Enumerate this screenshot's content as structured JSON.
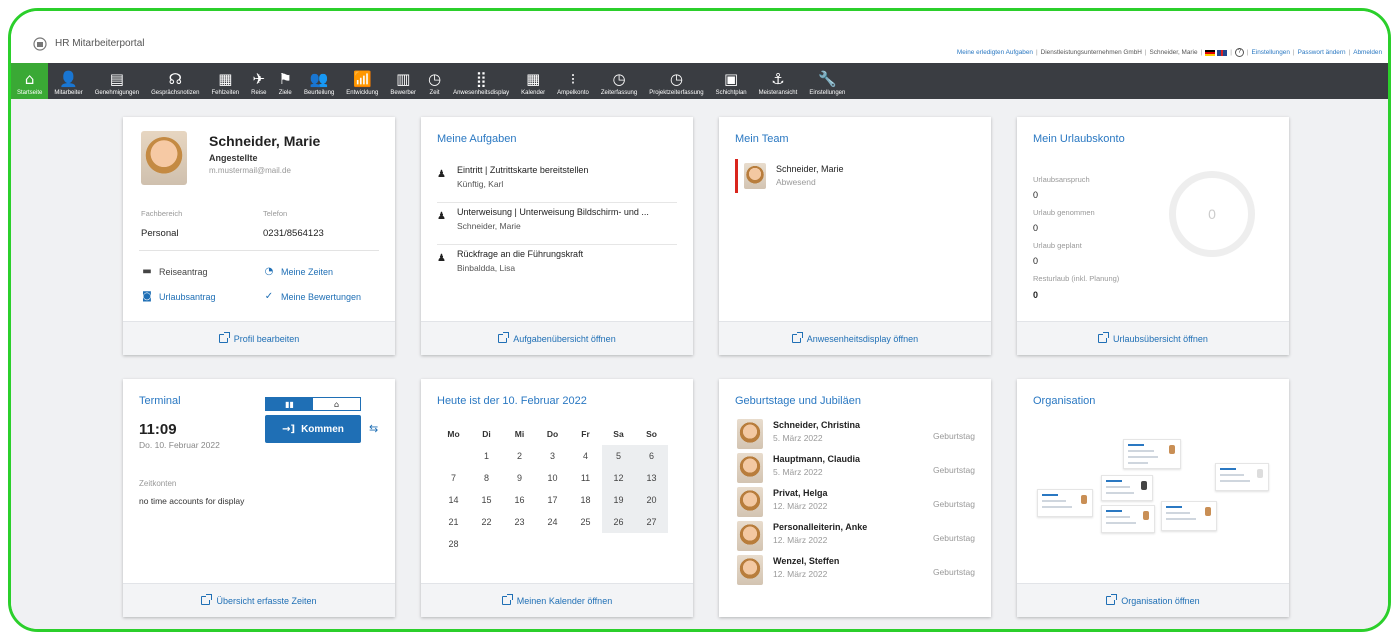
{
  "app": {
    "title": "HR Mitarbeiterportal"
  },
  "toplinks": {
    "done_tasks": "Meine erledigten Aufgaben",
    "company": "Dienstleistungsunternehmen GmbH",
    "user": "Schneider, Marie",
    "help": "?",
    "settings": "Einstellungen",
    "password": "Passwort ändern",
    "logout": "Abmelden"
  },
  "nav": [
    {
      "label": "Startseite",
      "icon": "home-icon",
      "glyph": "⌂"
    },
    {
      "label": "Mitarbeiter",
      "icon": "employee-icon",
      "glyph": "👤"
    },
    {
      "label": "Genehmigungen",
      "icon": "approvals-icon",
      "glyph": "▤"
    },
    {
      "label": "Gesprächsnotizen",
      "icon": "conversation-notes-icon",
      "glyph": "☊"
    },
    {
      "label": "Fehlzeiten",
      "icon": "calendar-icon",
      "glyph": "▦"
    },
    {
      "label": "Reise",
      "icon": "airplane-icon",
      "glyph": "✈"
    },
    {
      "label": "Ziele",
      "icon": "flag-icon",
      "glyph": "⚑"
    },
    {
      "label": "Beurteilung",
      "icon": "people-icon",
      "glyph": "👥"
    },
    {
      "label": "Entwicklung",
      "icon": "growth-icon",
      "glyph": "📶"
    },
    {
      "label": "Bewerber",
      "icon": "books-icon",
      "glyph": "▥"
    },
    {
      "label": "Zeit",
      "icon": "time-icon",
      "glyph": "◷"
    },
    {
      "label": "Anwesenheitsdisplay",
      "icon": "grid-icon",
      "glyph": "⣿"
    },
    {
      "label": "Kalender",
      "icon": "calendar-icon",
      "glyph": "▦"
    },
    {
      "label": "Ampelkonto",
      "icon": "traffic-light-icon",
      "glyph": "⁝"
    },
    {
      "label": "Zeiterfassung",
      "icon": "time-tracking-icon",
      "glyph": "◷"
    },
    {
      "label": "Projektzeiterfassung",
      "icon": "project-time-icon",
      "glyph": "◷"
    },
    {
      "label": "Schichtplan",
      "icon": "shift-plan-icon",
      "glyph": "▣"
    },
    {
      "label": "Meisteransicht",
      "icon": "anchor-icon",
      "glyph": "⚓"
    },
    {
      "label": "Einstellungen",
      "icon": "wrench-icon",
      "glyph": "🔧"
    }
  ],
  "profile": {
    "name": "Schneider, Marie",
    "role": "Angestellte",
    "email": "m.mustermail@mail.de",
    "dept_label": "Fachbereich",
    "dept_value": "Personal",
    "phone_label": "Telefon",
    "phone_value": "0231/8564123",
    "link_travel": "Reiseantrag",
    "link_times": "Meine Zeiten",
    "link_vacation": "Urlaubsantrag",
    "link_ratings": "Meine Bewertungen",
    "footer": "Profil bearbeiten"
  },
  "tasks": {
    "title": "Meine Aufgaben",
    "items": [
      {
        "title": "Eintritt | Zutrittskarte bereitstellen",
        "person": "Künftig, Karl"
      },
      {
        "title": "Unterweisung | Unterweisung Bildschirm- und ...",
        "person": "Schneider, Marie"
      },
      {
        "title": "Rückfrage an die Führungskraft",
        "person": "Binbaldda, Lisa"
      }
    ],
    "footer": "Aufgabenübersicht öffnen"
  },
  "team": {
    "title": "Mein Team",
    "member_name": "Schneider, Marie",
    "member_status": "Abwesend",
    "footer": "Anwesenheitsdisplay öffnen"
  },
  "vacation": {
    "title": "Mein Urlaubskonto",
    "entitlement_label": "Urlaubsanspruch",
    "entitlement": "0",
    "taken_label": "Urlaub genommen",
    "taken": "0",
    "planned_label": "Urlaub geplant",
    "planned": "0",
    "rest_label": "Resturlaub (inkl. Planung)",
    "rest": "0",
    "ring_value": "0",
    "footer": "Urlaubsübersicht öffnen"
  },
  "terminal": {
    "title": "Terminal",
    "time": "11:09",
    "date": "Do. 10. Februar 2022",
    "button": "Kommen",
    "accounts_label": "Zeitkonten",
    "accounts_value": "no time accounts for display",
    "footer": "Übersicht erfasste Zeiten"
  },
  "calendar": {
    "title": "Heute ist der 10. Februar 2022",
    "weekdays": [
      "Mo",
      "Di",
      "Mi",
      "Do",
      "Fr",
      "Sa",
      "So"
    ],
    "weeks": [
      [
        "",
        "1",
        "2",
        "3",
        "4",
        "5",
        "6"
      ],
      [
        "7",
        "8",
        "9",
        "10",
        "11",
        "12",
        "13"
      ],
      [
        "14",
        "15",
        "16",
        "17",
        "18",
        "19",
        "20"
      ],
      [
        "21",
        "22",
        "23",
        "24",
        "25",
        "26",
        "27"
      ],
      [
        "28",
        "",
        "",
        "",
        "",
        "",
        ""
      ]
    ],
    "footer": "Meinen Kalender öffnen"
  },
  "birthdays": {
    "title": "Geburtstage und Jubiläen",
    "items": [
      {
        "name": "Schneider, Christina",
        "date": "5. März 2022",
        "event": "Geburtstag"
      },
      {
        "name": "Hauptmann, Claudia",
        "date": "5. März 2022",
        "event": "Geburtstag"
      },
      {
        "name": "Privat, Helga",
        "date": "12. März 2022",
        "event": "Geburtstag"
      },
      {
        "name": "Personalleiterin, Anke",
        "date": "12. März 2022",
        "event": "Geburtstag"
      },
      {
        "name": "Wenzel, Steffen",
        "date": "12. März 2022",
        "event": "Geburtstag"
      }
    ]
  },
  "organisation": {
    "title": "Organisation",
    "footer": "Organisation öffnen"
  }
}
